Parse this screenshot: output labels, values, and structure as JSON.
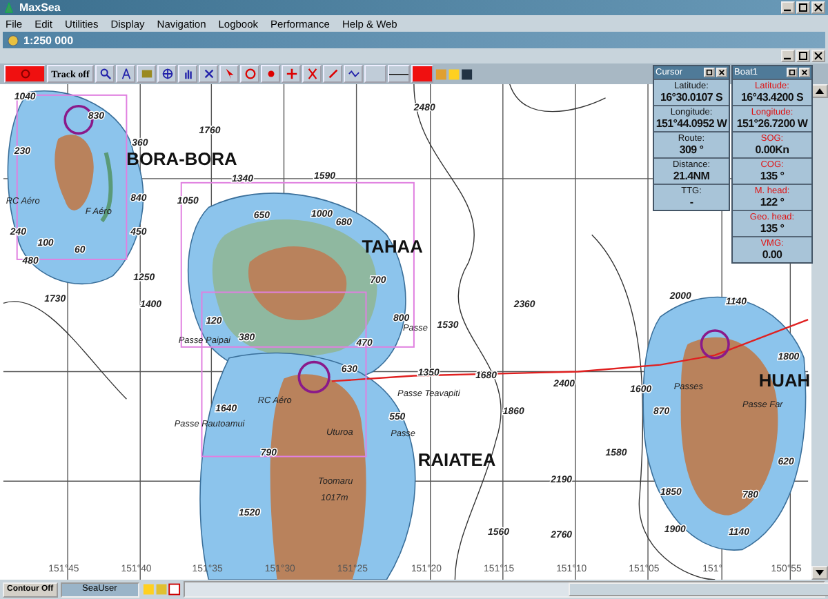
{
  "window": {
    "title": "MaxSea"
  },
  "menu": [
    "File",
    "Edit",
    "Utilities",
    "Display",
    "Navigation",
    "Logbook",
    "Performance",
    "Help & Web"
  ],
  "chart_window": {
    "title": "1:250 000"
  },
  "toolbar": {
    "track_button": "Track off"
  },
  "map": {
    "island_names": [
      "BORA-BORA",
      "TAHAA",
      "RAIATEA",
      "HUAH"
    ],
    "place_labels": [
      "Passe Paipai",
      "Passe Teavapiti",
      "Passe Rautoamui",
      "RC Aéro",
      "Uturoa",
      "Toomaru",
      "1017m",
      "RC Aéro",
      "F Aéro",
      "Passes",
      "Passe Far",
      "Passe",
      "Passe"
    ],
    "soundings": [
      "1040",
      "2480",
      "830",
      "1760",
      "230",
      "360",
      "1340",
      "1590",
      "840",
      "1050",
      "650",
      "1000",
      "680",
      "240",
      "450",
      "100",
      "60",
      "480",
      "1250",
      "700",
      "1730",
      "1400",
      "2360",
      "2000",
      "1140",
      "120",
      "800",
      "1530",
      "380",
      "470",
      "1800",
      "630",
      "1350",
      "1680",
      "2400",
      "1600",
      "1640",
      "550",
      "1860",
      "870",
      "790",
      "1580",
      "620",
      "2190",
      "1850",
      "780",
      "1520",
      "1560",
      "2760",
      "1900",
      "1140"
    ],
    "longitude_labels": [
      "151°45",
      "151°40",
      "151°35",
      "151°30",
      "151°25",
      "151°20",
      "151°15",
      "151°10",
      "151°05",
      "151°",
      "150°55"
    ]
  },
  "cursor_panel": {
    "title": "Cursor",
    "fields": [
      {
        "label": "Latitude:",
        "value": "16°30.0107 S"
      },
      {
        "label": "Longitude:",
        "value": "151°44.0952 W"
      },
      {
        "label": "Route:",
        "value": "309 °"
      },
      {
        "label": "Distance:",
        "value": "21.4NM"
      },
      {
        "label": "TTG:",
        "value": "-"
      }
    ]
  },
  "boat_panel": {
    "title": "Boat1",
    "fields": [
      {
        "label": "Latitude:",
        "value": "16°43.4200 S"
      },
      {
        "label": "Longitude:",
        "value": "151°26.7200 W"
      },
      {
        "label": "SOG:",
        "value": "0.00Kn"
      },
      {
        "label": "COG:",
        "value": "135 °"
      },
      {
        "label": "M. head:",
        "value": "122 °"
      },
      {
        "label": "Geo. head:",
        "value": "135 °"
      },
      {
        "label": "VMG:",
        "value": "0.00"
      }
    ]
  },
  "status_bar": {
    "contour_button": "Contour Off",
    "user": "SeaUser"
  }
}
